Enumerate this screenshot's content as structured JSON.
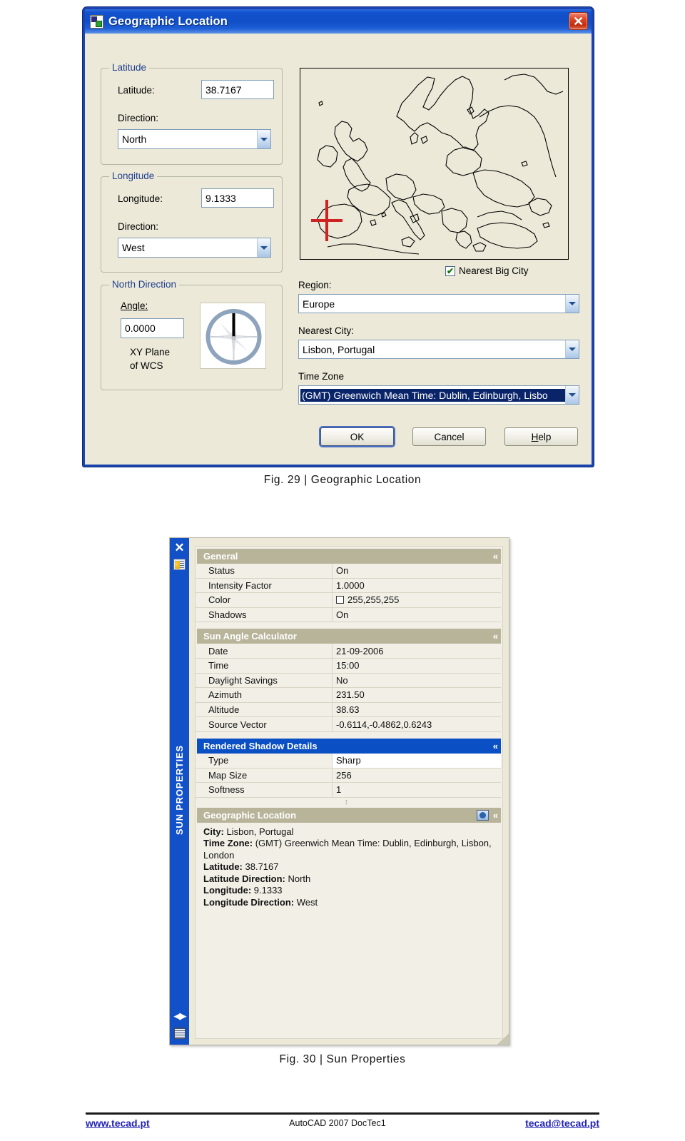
{
  "dialog": {
    "title": "Geographic Location",
    "title_icon": "geographic-location-icon",
    "close_label": "✕",
    "latitude_group": {
      "legend": "Latitude",
      "value_label": "Latitude:",
      "value": "38.7167",
      "direction_label": "Direction:",
      "direction_value": "North"
    },
    "longitude_group": {
      "legend": "Longitude",
      "value_label": "Longitude:",
      "value": "9.1333",
      "direction_label": "Direction:",
      "direction_value": "West"
    },
    "north_group": {
      "legend": "North Direction",
      "angle_label": "Angle:",
      "angle_value": "0.0000",
      "note_line1": "XY Plane",
      "note_line2": "of WCS"
    },
    "map": {
      "name": "europe-map",
      "marker_color": "#cf2222"
    },
    "nearest_big_city": {
      "label": "Nearest Big City",
      "checked": true,
      "check_glyph": "✔"
    },
    "region_label": "Region:",
    "region_value": "Europe",
    "nearest_city_label": "Nearest City:",
    "nearest_city_value": "Lisbon, Portugal",
    "time_zone_label": "Time Zone",
    "time_zone_value": "(GMT) Greenwich Mean Time: Dublin, Edinburgh, Lisbo",
    "buttons": {
      "ok": "OK",
      "cancel": "Cancel",
      "help_pre": "H",
      "help_post": "elp"
    }
  },
  "captions": {
    "fig29": "Fig. 29 |  Geographic Location",
    "fig30": "Fig. 30 |  Sun Properties"
  },
  "palette": {
    "rail": {
      "close_glyph": "✕",
      "top_icon": "sun-properties-icon",
      "title": "SUN PROPERTIES",
      "arrows_glyph": "◀▶",
      "menu_icon": "palette-menu-icon"
    },
    "sections": [
      {
        "name": "general",
        "title": "General",
        "selected": false,
        "chevron": "«",
        "rows": [
          {
            "name": "Status",
            "value": "On",
            "white": false,
            "swatch": false
          },
          {
            "name": "Intensity Factor",
            "value": "1.0000",
            "white": false,
            "swatch": false
          },
          {
            "name": "Color",
            "value": "255,255,255",
            "white": false,
            "swatch": true,
            "swatch_color": "#ffffff"
          },
          {
            "name": "Shadows",
            "value": "On",
            "white": false,
            "swatch": false
          }
        ]
      },
      {
        "name": "sun-angle-calculator",
        "title": "Sun Angle Calculator",
        "selected": false,
        "chevron": "«",
        "rows": [
          {
            "name": "Date",
            "value": "21-09-2006",
            "white": false,
            "swatch": false
          },
          {
            "name": "Time",
            "value": "15:00",
            "white": false,
            "swatch": false
          },
          {
            "name": "Daylight Savings",
            "value": "No",
            "white": false,
            "swatch": false
          },
          {
            "name": "Azimuth",
            "value": "231.50",
            "white": false,
            "swatch": false
          },
          {
            "name": "Altitude",
            "value": "38.63",
            "white": false,
            "swatch": false
          },
          {
            "name": "Source Vector",
            "value": "-0.6114,-0.4862,0.6243",
            "white": false,
            "swatch": false
          }
        ]
      },
      {
        "name": "rendered-shadow-details",
        "title": "Rendered Shadow Details",
        "selected": true,
        "chevron": "«",
        "rows": [
          {
            "name": "Type",
            "value": "Sharp",
            "white": true,
            "swatch": false
          },
          {
            "name": "Map Size",
            "value": "256",
            "white": false,
            "swatch": false
          },
          {
            "name": "Softness",
            "value": "1",
            "white": false,
            "swatch": false
          }
        ]
      }
    ],
    "geo_section": {
      "title": "Geographic Location",
      "chevron": "«",
      "has_map_button": true,
      "map_button_icon": "geo-map-icon",
      "info": [
        {
          "label": "City:",
          "value": " Lisbon, Portugal"
        },
        {
          "label": "Time Zone:",
          "value": " (GMT) Greenwich Mean Time: Dublin, Edinburgh, Lisbon, London"
        },
        {
          "label": "Latitude:",
          "value": " 38.7167"
        },
        {
          "label": "Latitude Direction:",
          "value": " North"
        },
        {
          "label": "Longitude:",
          "value": " 9.1333"
        },
        {
          "label": "Longitude Direction:",
          "value": " West"
        }
      ]
    }
  },
  "footer": {
    "left": "www.tecad.pt",
    "middle": "AutoCAD 2007 DocTec1",
    "right": "tecad@tecad.pt"
  }
}
